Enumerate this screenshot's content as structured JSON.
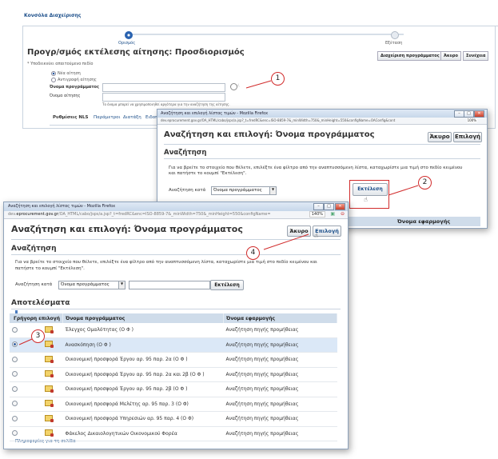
{
  "base_page": {
    "tab_label": "Κονσόλα Διαχείρισης",
    "train_start": "Ορισμός",
    "train_end": "Εξέταση",
    "page_title": "Προγρ/σμός εκτέλεσης αίτησης: Προσδιορισμός",
    "buttons": {
      "manage": "Διαχείριση προγράμματος",
      "cancel": "Άκυρο",
      "continue": "Συνέχεια"
    },
    "required_note": "* Υποδεικνύει απαιτούμενο πεδίο",
    "radio_new": "Νέα αίτηση",
    "radio_copy": "Αντιγραφή αίτησης",
    "program_name_label": "Όνομα προγράμματος",
    "request_name_label": "Όνομα αίτησης",
    "hint": "Το όνομα μπορεί να χρησιμοποιηθεί αργότερα για την αναζήτηση της αίτησης.",
    "tabs": [
      "Ρυθμίσεις NLS",
      "Παράμετροι",
      "Διατάξη",
      "Ειδοπ"
    ]
  },
  "window1": {
    "title": "Αναζήτηση και επιλογή λίστας τιμών - Mozilla Firefox",
    "url": "dev.eprocurement.gov.gr/OA_HTML/cabo/jsps/a.jsp?_t=fredRC&enc=ISO-8859-7&_minWidth=750&_minHeight=550&configName=OAConfig&cont",
    "zoom": "100%",
    "heading": "Αναζήτηση και επιλογή: Όνομα προγράμματος",
    "cancel": "Άκυρο",
    "select": "Επιλογή",
    "search_section": "Αναζήτηση",
    "instructions": "Για να βρείτε το στοιχείο που θέλετε, επιλέξτε ένα φίλτρο από την αναπτυσσόμενη λίστα, καταχωρίστε μια τιμή στο πεδίο κειμένου και πατήστε το κουμπί \"Εκτέλεση\".",
    "search_by_label": "Αναζήτηση κατά",
    "search_by_value": "Όνομα προγράμματος",
    "execute": "Εκτέλεση",
    "col_app": "Όνομα εφαρμογής"
  },
  "window2": {
    "title": "Αναζήτηση και επιλογή λίστας τιμών - Mozilla Firefox",
    "url_prefix": "dev.",
    "url_domain": "eprocurement.gov.gr",
    "url_rest": "/OA_HTML/cabo/jsps/a.jsp?_t=fredRC&enc=ISO-8859-7&_minWidth=750&_minHeight=550&configName=",
    "zoom": "140%",
    "heading": "Αναζήτηση και επιλογή: Όνομα προγράμματος",
    "cancel": "Άκυρο",
    "select": "Επιλογή",
    "search_section": "Αναζήτηση",
    "instructions": "Για να βρείτε το στοιχείο που θέλετε, επιλέξτε ένα φίλτρο από την αναπτυσσόμενη λίστα, καταχωρίστε μια τιμή στο πεδίο κειμένου και πατήστε το κουμπί \"Εκτέλεση\".",
    "search_by_label": "Αναζήτηση κατά",
    "search_by_value": "Όνομα προγράμματος",
    "execute": "Εκτέλεση",
    "results_section": "Αποτελέσματα",
    "columns": [
      "Γρήγορη επιλογή",
      "Όνομα προγράμματος",
      "Όνομα εφαρμογής"
    ],
    "rows": [
      {
        "program": "Έλεγχος Ομαλότητας (Ο Φ )",
        "app": "Αναζήτηση πηγής προμήθειας",
        "selected": false
      },
      {
        "program": "Ανασκόπηση (Ο Φ )",
        "app": "Αναζήτηση πηγής προμήθειας",
        "selected": true
      },
      {
        "program": "Οικονομική προσφορά Έργου αρ. 95 παρ. 2α (Ο Φ )",
        "app": "Αναζήτηση πηγής προμήθειας",
        "selected": false
      },
      {
        "program": "Οικονομική προσφορά Έργου αρ. 95 παρ. 2α και 2β (Ο Φ )",
        "app": "Αναζήτηση πηγής προμήθειας",
        "selected": false
      },
      {
        "program": "Οικονομική προσφορά Έργου αρ. 95 παρ. 2β (Ο Φ )",
        "app": "Αναζήτηση πηγής προμήθειας",
        "selected": false
      },
      {
        "program": "Οικονομική προσφορά Μελέτης αρ. 95 παρ. 3 (Ο Φ)",
        "app": "Αναζήτηση πηγής προμήθειας",
        "selected": false
      },
      {
        "program": "Οικονομική προσφορά Υπηρεσιών αρ. 95 παρ. 4 (Ο Φ)",
        "app": "Αναζήτηση πηγής προμήθειας",
        "selected": false
      },
      {
        "program": "Φάκελος Δικαιολογητικών Οικονομικού Φορέα",
        "app": "Αναζήτηση πηγής προμήθειας",
        "selected": false
      }
    ],
    "footer_link": "Πληροφορίες για τη σελίδα"
  },
  "callouts": [
    "1",
    "2",
    "3",
    "4"
  ],
  "colors": {
    "accent": "#1c4f8a",
    "callout": "#d12b2b",
    "header_bg": "#cfdcea",
    "selected_row": "#dbe8f7"
  }
}
